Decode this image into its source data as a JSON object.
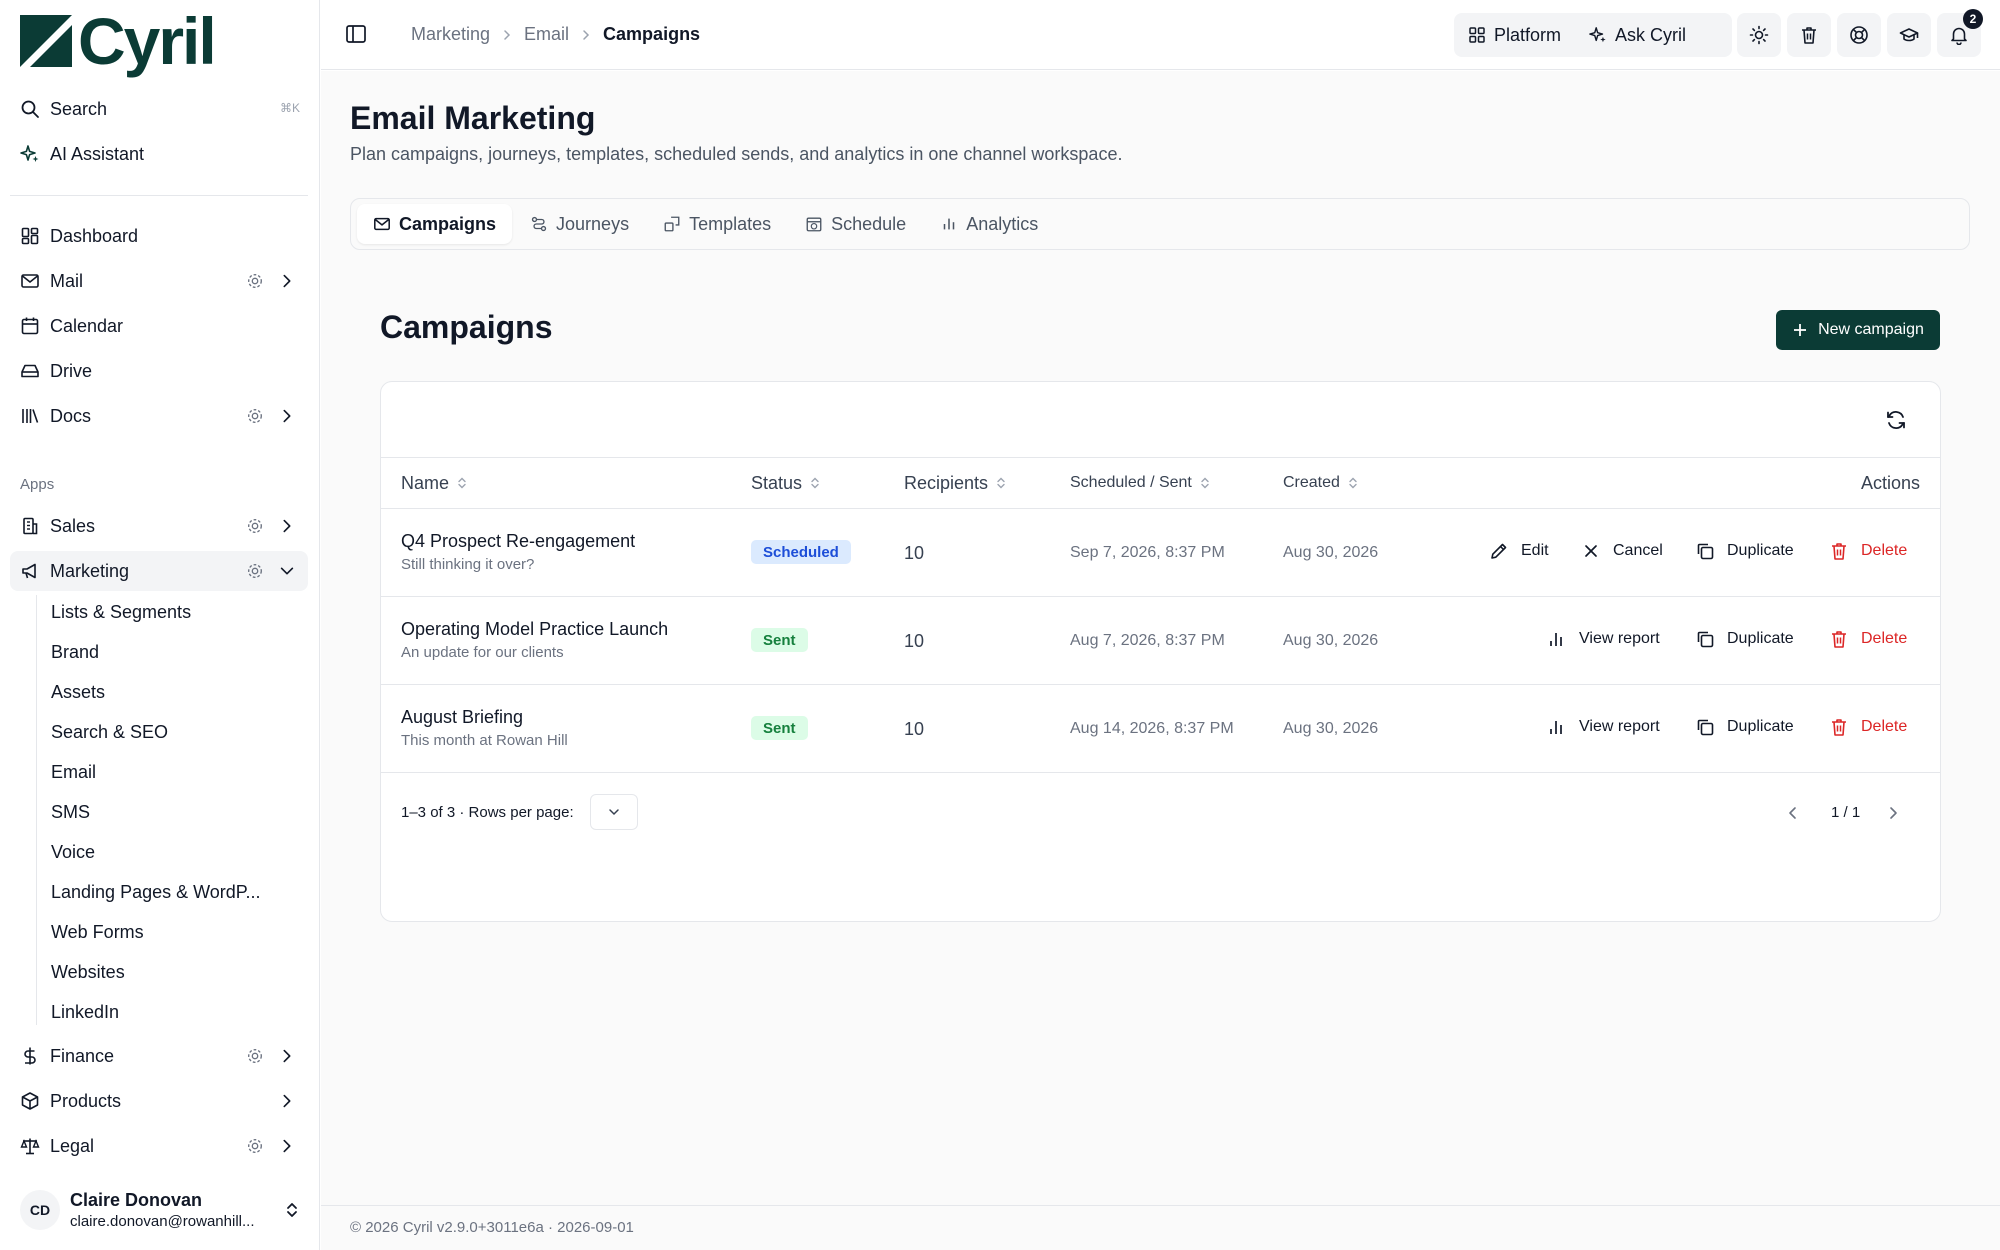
{
  "brand": {
    "name": "Cyril",
    "color": "#0b3b35"
  },
  "sidebar": {
    "search_label": "Search",
    "search_shortcut": "⌘K",
    "ai_label": "AI Assistant",
    "nav": [
      {
        "label": "Dashboard",
        "icon": "dashboard-icon"
      },
      {
        "label": "Mail",
        "icon": "mail-icon"
      },
      {
        "label": "Calendar",
        "icon": "calendar-icon"
      },
      {
        "label": "Drive",
        "icon": "drive-icon"
      },
      {
        "label": "Docs",
        "icon": "docs-icon"
      }
    ],
    "apps_heading": "Apps",
    "apps": [
      {
        "label": "Sales",
        "icon": "sales-icon"
      },
      {
        "label": "Marketing",
        "icon": "marketing-icon"
      }
    ],
    "marketing_items": [
      "Lists & Segments",
      "Brand",
      "Assets",
      "Search & SEO",
      "Email",
      "SMS",
      "Voice",
      "Landing Pages & WordP...",
      "Web Forms",
      "Websites",
      "LinkedIn"
    ],
    "apps_bottom": [
      {
        "label": "Finance",
        "icon": "finance-icon"
      },
      {
        "label": "Products",
        "icon": "products-icon"
      },
      {
        "label": "Legal",
        "icon": "legal-icon"
      }
    ],
    "user": {
      "initials": "CD",
      "name": "Claire Donovan",
      "email": "claire.donovan@rowanhill..."
    }
  },
  "topbar": {
    "breadcrumb": [
      "Marketing",
      "Email",
      "Campaigns"
    ],
    "platform_label": "Platform",
    "ask_label": "Ask Cyril",
    "notification_count": "2"
  },
  "page": {
    "title": "Email Marketing",
    "subtitle": "Plan campaigns, journeys, templates, scheduled sends, and analytics in one channel workspace.",
    "tabs": [
      {
        "label": "Campaigns",
        "icon": "mail-icon",
        "active": true
      },
      {
        "label": "Journeys",
        "icon": "journeys-icon",
        "active": false
      },
      {
        "label": "Templates",
        "icon": "templates-icon",
        "active": false
      },
      {
        "label": "Schedule",
        "icon": "schedule-icon",
        "active": false
      },
      {
        "label": "Analytics",
        "icon": "analytics-icon",
        "active": false
      }
    ]
  },
  "campaigns": {
    "title": "Campaigns",
    "new_button": "New campaign",
    "columns": {
      "name": "Name",
      "status": "Status",
      "recipients": "Recipients",
      "scheduled": "Scheduled / Sent",
      "created": "Created",
      "actions": "Actions"
    },
    "rows": [
      {
        "name": "Q4 Prospect Re-engagement",
        "subject": "Still thinking it over?",
        "status": "Scheduled",
        "recipients": "10",
        "scheduled": "Sep 7, 2026, 8:37 PM",
        "created": "Aug 30, 2026",
        "actions": [
          "Edit",
          "Cancel",
          "Duplicate",
          "Delete"
        ]
      },
      {
        "name": "Operating Model Practice Launch",
        "subject": "An update for our clients",
        "status": "Sent",
        "recipients": "10",
        "scheduled": "Aug 7, 2026, 8:37 PM",
        "created": "Aug 30, 2026",
        "actions": [
          "View report",
          "Duplicate",
          "Delete"
        ]
      },
      {
        "name": "August Briefing",
        "subject": "This month at Rowan Hill",
        "status": "Sent",
        "recipients": "10",
        "scheduled": "Aug 14, 2026, 8:37 PM",
        "created": "Aug 30, 2026",
        "actions": [
          "View report",
          "Duplicate",
          "Delete"
        ]
      }
    ],
    "pagination": {
      "range": "1–3 of 3",
      "rows_per_page": "· Rows per page:",
      "page": "1 / 1"
    }
  },
  "footer": {
    "text": "© 2026 Cyril v2.9.0+3011e6a · 2026-09-01"
  }
}
